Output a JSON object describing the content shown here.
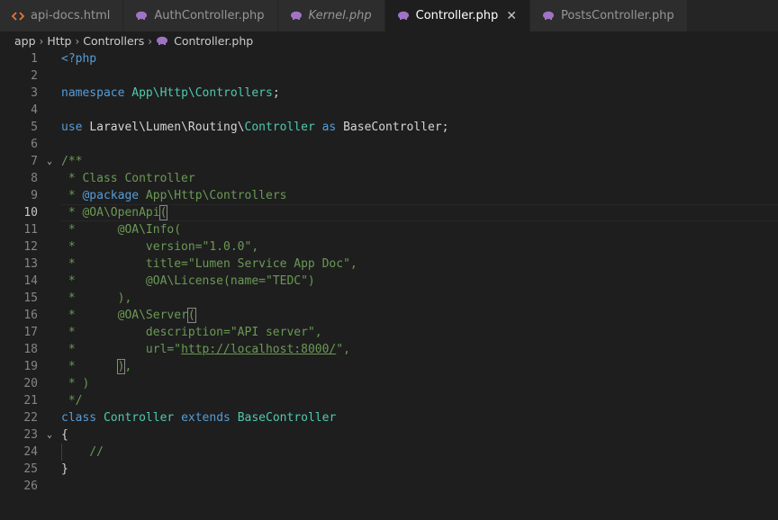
{
  "colors": {
    "keyword": "#569cd6",
    "type": "#4ec9b0",
    "comment": "#6a9955",
    "html_icon": "#e37933",
    "php_icon": "#a074c4"
  },
  "tabs": [
    {
      "label": "api-docs.html",
      "icon": "html-icon",
      "active": false
    },
    {
      "label": "AuthController.php",
      "icon": "php-icon",
      "active": false
    },
    {
      "label": "Kernel.php",
      "icon": "php-icon",
      "active": false,
      "italic": true
    },
    {
      "label": "Controller.php",
      "icon": "php-icon",
      "active": true,
      "close": "✕"
    },
    {
      "label": "PostsController.php",
      "icon": "php-icon",
      "active": false
    }
  ],
  "breadcrumb": [
    "app",
    "Http",
    "Controllers",
    "Controller.php"
  ],
  "breadcrumb_sep": "›",
  "line_numbers": [
    "1",
    "2",
    "3",
    "4",
    "5",
    "6",
    "7",
    "8",
    "9",
    "10",
    "11",
    "12",
    "13",
    "14",
    "15",
    "16",
    "17",
    "18",
    "19",
    "20",
    "21",
    "22",
    "23",
    "24",
    "25",
    "26"
  ],
  "code": {
    "l1": "<?php",
    "l3_kw": "namespace",
    "l3_ns": "App\\Http\\Controllers",
    "l3_end": ";",
    "l5_kw": "use",
    "l5_ns1": "Laravel\\Lumen\\Routing\\",
    "l5_cls": "Controller",
    "l5_as": "as",
    "l5_alias": "BaseController",
    "l5_end": ";",
    "l7": "/**",
    "l8": " * Class Controller",
    "l9_a": " * ",
    "l9_tag": "@package",
    "l9_b": " App\\Http\\Controllers",
    "l10_a": " * @OA\\OpenApi",
    "l10_b": "(",
    "l11": " *      @OA\\Info(",
    "l12": " *          version=\"1.0.0\",",
    "l13": " *          title=\"Lumen Service App Doc\",",
    "l14": " *          @OA\\License(name=\"TEDC\")",
    "l15": " *      ),",
    "l16_a": " *      @OA\\Server",
    "l16_b": "(",
    "l17": " *          description=\"API server\",",
    "l18_a": " *          url=\"",
    "l18_link": "http://localhost:8000/",
    "l18_b": "\",",
    "l19_a": " *      ",
    "l19_b": ")",
    "l19_c": ",",
    "l20": " * )",
    "l21": " */",
    "l22_kw1": "class",
    "l22_cls": "Controller",
    "l22_kw2": "extends",
    "l22_base": "BaseController",
    "l23": "{",
    "l24": "    //",
    "l25": "}"
  }
}
